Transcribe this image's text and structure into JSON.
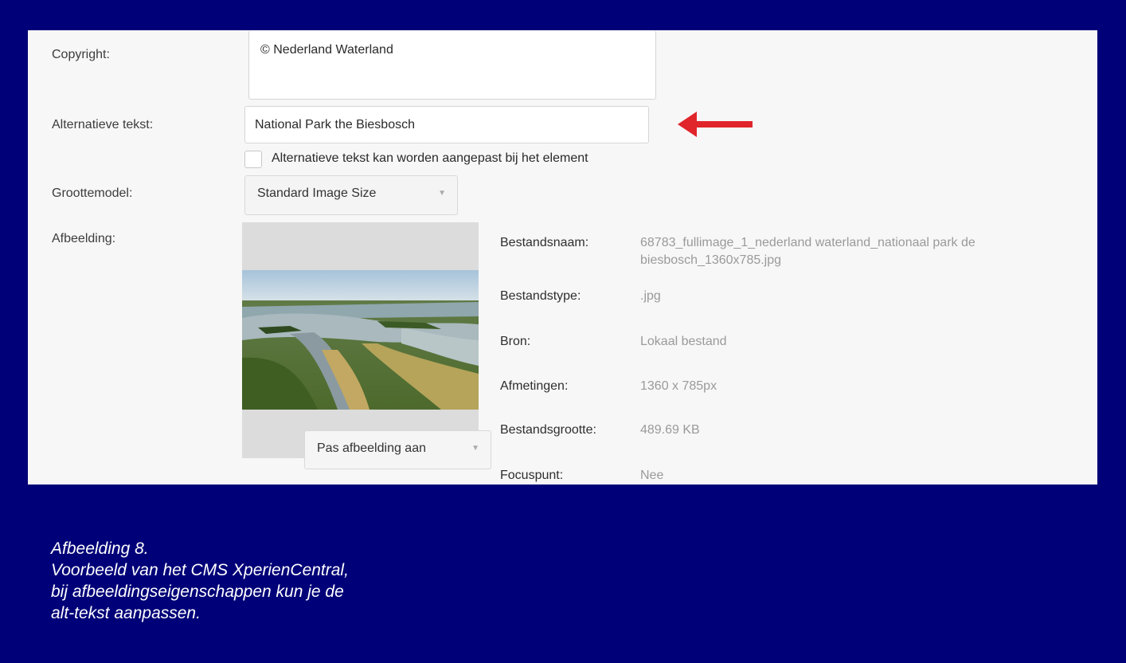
{
  "form": {
    "copyright_label": "Copyright:",
    "copyright_value": "© Nederland Waterland",
    "alt_label": "Alternatieve tekst:",
    "alt_value": "National Park the Biesbosch",
    "alt_checkbox_label": "Alternatieve tekst kan worden aangepast bij het element",
    "size_label": "Groottemodel:",
    "size_value": "Standard Image Size",
    "image_label": "Afbeelding:",
    "edit_image_label": "Pas afbeelding aan"
  },
  "metadata": {
    "filename_label": "Bestandsnaam:",
    "filename_line1": "68783_fullimage_1_nederland waterland_nationaal park de",
    "filename_line2": "biesbosch_1360x785.jpg",
    "filetype_label": "Bestandstype:",
    "filetype_value": ".jpg",
    "source_label": "Bron:",
    "source_value": "Lokaal bestand",
    "dimensions_label": "Afmetingen:",
    "dimensions_value": "1360 x 785px",
    "filesize_label": "Bestandsgrootte:",
    "filesize_value": "489.69 KB",
    "focus_label": "Focuspunt:",
    "focus_value": "Nee"
  },
  "caption": {
    "line1": "Afbeelding 8.",
    "line2": "Voorbeeld van het CMS XperienCentral,",
    "line3": "bij afbeeldingseigenschappen kun je de",
    "line4": "alt-tekst aanpassen."
  },
  "colors": {
    "background": "#000078",
    "panel": "#f7f7f7",
    "arrow": "#e0262b"
  },
  "icons": {
    "arrow": "left-arrow-icon",
    "dropdown": "chevron-down-icon"
  }
}
